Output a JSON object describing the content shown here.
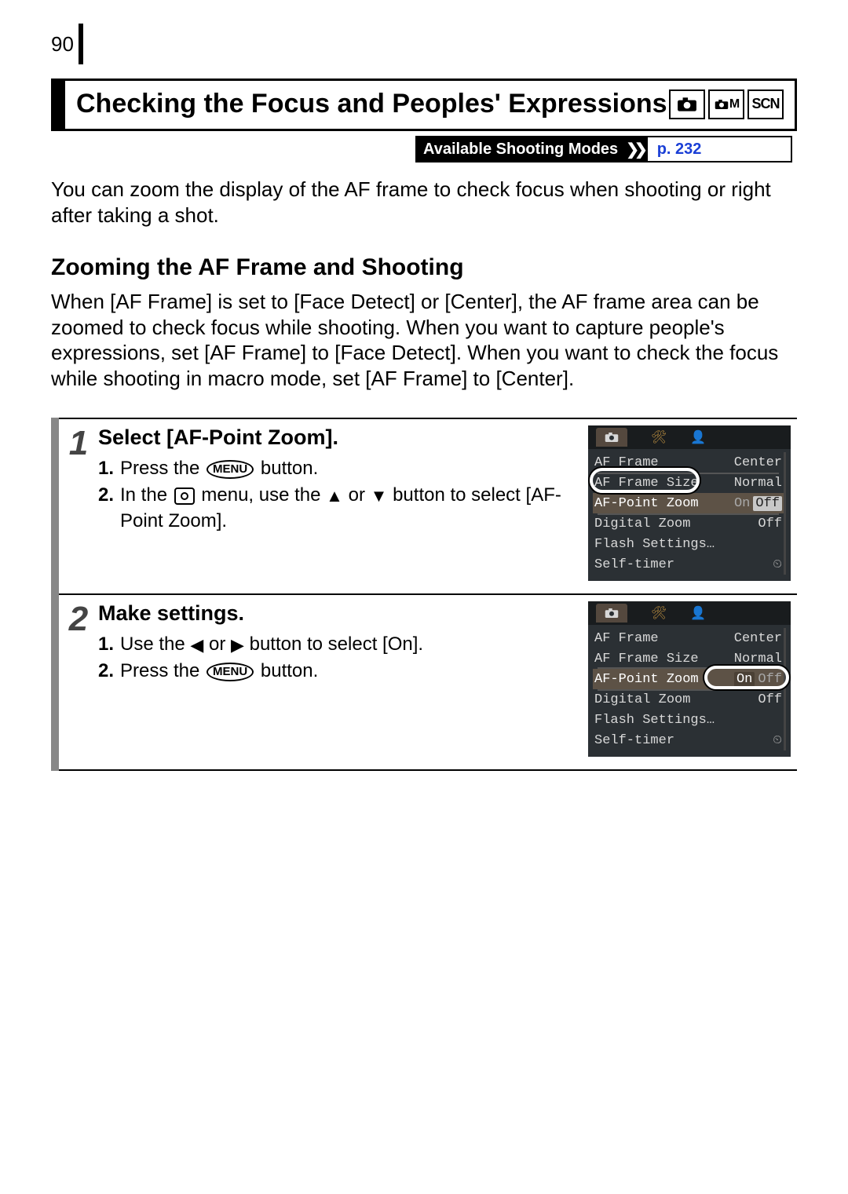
{
  "page_number": "90",
  "title": "Checking the Focus and Peoples' Expressions",
  "mode_icons": {
    "scn": "SCN",
    "manual": "M"
  },
  "available_modes": {
    "label": "Available Shooting Modes",
    "page_ref": "p. 232"
  },
  "intro": "You can zoom the display of the AF frame to check focus when shooting or right after taking a shot.",
  "section_heading": "Zooming the AF Frame and Shooting",
  "section_body": "When [AF Frame] is set to [Face Detect] or [Center], the AF frame area can be zoomed to check focus while shooting. When you want to capture people's expressions, set [AF Frame] to [Face Detect]. When you want to check the focus while shooting in macro mode, set [AF Frame] to [Center].",
  "steps": [
    {
      "num": "1",
      "title": "Select [AF-Point Zoom].",
      "substeps": [
        {
          "n": "1.",
          "pre": "Press the ",
          "btn": "MENU",
          "post": " button."
        },
        {
          "n": "2.",
          "pre": "In the ",
          "rec": true,
          "mid": " menu, use the ",
          "arr1": "▲",
          "or": " or ",
          "arr2": "▼",
          "post2": " button to select [AF-Point Zoom]."
        }
      ]
    },
    {
      "num": "2",
      "title": "Make settings.",
      "substeps": [
        {
          "n": "1.",
          "pre": "Use the ",
          "arr1": "◀",
          "or": " or ",
          "arr2": "▶",
          "post2": " button to select [On]."
        },
        {
          "n": "2.",
          "pre": "Press the ",
          "btn": "MENU",
          "post": " button."
        }
      ]
    }
  ],
  "lcd1": {
    "rows": [
      {
        "label": "AF Frame",
        "val": "Center"
      },
      {
        "label": "AF Frame Size",
        "val": "Normal",
        "trunc_top": true
      },
      {
        "label": "AF-Point Zoom",
        "on": "On",
        "off": "Off",
        "off_sel": true,
        "hl": true,
        "circle_label": true
      },
      {
        "label": "Digital Zoom",
        "val": "Off",
        "trunc_top": true
      },
      {
        "label": "Flash Settings…",
        "val": ""
      },
      {
        "label": "Self-timer",
        "timer": "⏲"
      }
    ]
  },
  "lcd2": {
    "rows": [
      {
        "label": "AF Frame",
        "val": "Center"
      },
      {
        "label": "AF Frame Size",
        "val": "Normal",
        "trunc_bot": true
      },
      {
        "label": "AF-Point Zoom",
        "on": "On",
        "off": "Off",
        "on_sel": true,
        "hl": true,
        "circle_value": true
      },
      {
        "label": "Digital Zoom",
        "val": "Off",
        "trunc_top": true
      },
      {
        "label": "Flash Settings…",
        "val": ""
      },
      {
        "label": "Self-timer",
        "timer": "⏲"
      }
    ]
  }
}
